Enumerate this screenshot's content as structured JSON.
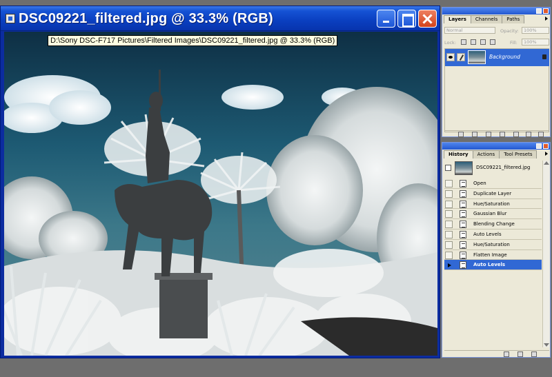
{
  "document": {
    "title": "DSC09221_filtered.jpg @ 33.3% (RGB)",
    "tooltip": "D:\\Sony DSC-F717 Pictures\\Filtered Images\\DSC09221_filtered.jpg @ 33.3% (RGB)",
    "image_description_icon": "photo-canvas"
  },
  "layers_palette": {
    "tabs": [
      "Layers",
      "Channels",
      "Paths"
    ],
    "active_tab": "Layers",
    "blend_mode": "Normal",
    "opacity_label": "Opacity:",
    "opacity_value": "100%",
    "lock_label": "Lock:",
    "fill_label": "Fill:",
    "fill_value": "100%",
    "layers": [
      {
        "name": "Background",
        "locked": true,
        "visible": true
      }
    ]
  },
  "history_palette": {
    "tabs": [
      "History",
      "Actions",
      "Tool Presets"
    ],
    "active_tab": "History",
    "snapshot_name": "DSC09221_filtered.jpg",
    "states": [
      "Open",
      "Duplicate Layer",
      "Hue/Saturation",
      "Gaussian Blur",
      "Blending Change",
      "Auto Levels",
      "Hue/Saturation",
      "Flatten Image",
      "Auto Levels"
    ],
    "active_state_index": 8
  },
  "colors": {
    "title_bar": "#0a3fc0",
    "selection": "#3168d4",
    "palette_bg": "#ece9d8",
    "close_button": "#d2431c"
  }
}
